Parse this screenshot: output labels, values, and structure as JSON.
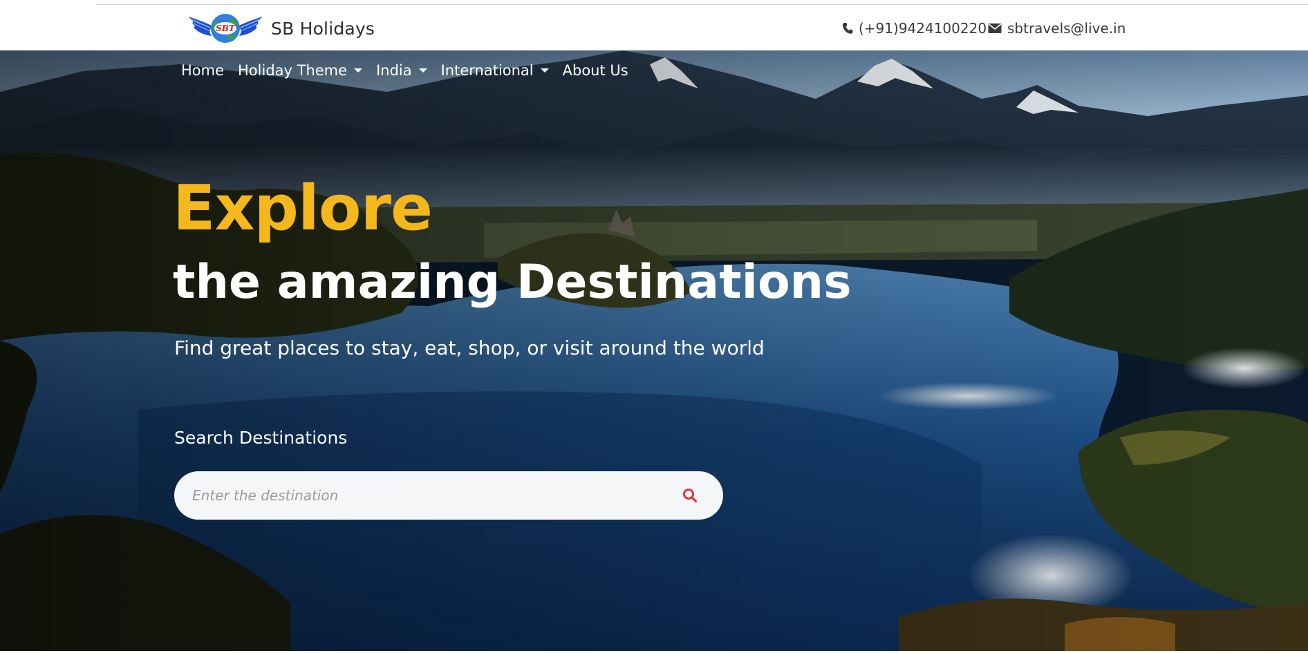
{
  "header": {
    "logo_text": "SBT",
    "brand_name": "SB Holidays",
    "phone": "(+91)9424100220",
    "email": "sbtravels@live.in"
  },
  "nav": {
    "home": "Home",
    "holiday_theme": "Holiday Theme",
    "india": "India",
    "international": "International",
    "about_us": "About Us"
  },
  "hero": {
    "headline_accent": "Explore",
    "headline_main": "the amazing Destinations",
    "tagline": "Find great places to stay, eat, shop, or visit around the world",
    "search_label": "Search Destinations",
    "search_placeholder": "Enter the destination",
    "background": "mountain lake at dawn"
  },
  "colors": {
    "accent": "#f4b81c",
    "search_icon": "#d9373a",
    "brand_blue": "#1f4fd1"
  },
  "icons": [
    "phone-icon",
    "envelope-icon",
    "search-icon",
    "chevron-down-icon"
  ]
}
